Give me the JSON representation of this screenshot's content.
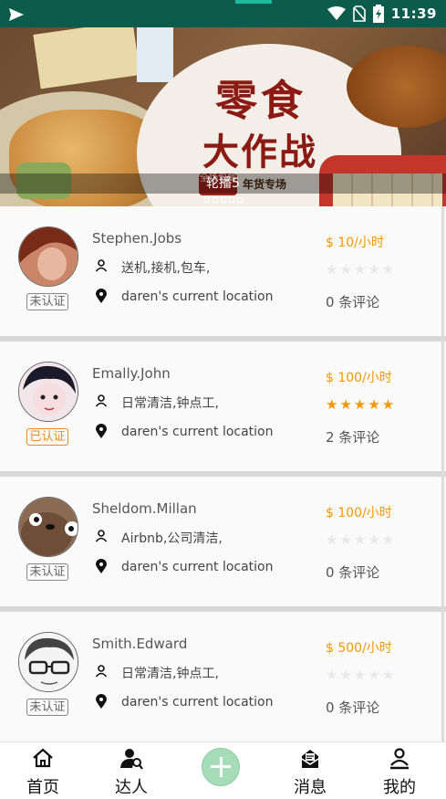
{
  "status_bar": {
    "time": "11:39",
    "icons": [
      "send-icon",
      "wifi-icon",
      "no-sim-icon",
      "battery-charging-icon"
    ]
  },
  "banner": {
    "title_line1": "零食",
    "title_line2": "大作战",
    "badge": "全场包邮",
    "subtitle": "年货专场",
    "caption": "轮播5",
    "dot_count": 5
  },
  "experts": [
    {
      "name": "Stephen.Jobs",
      "skills": "送机,接机,包车,",
      "location": "daren's current location",
      "price": "$ 10/小时",
      "rating": 0,
      "reviews": "0 条评论",
      "verify": "未认证",
      "verified": false
    },
    {
      "name": "Emally.John",
      "skills": "日常清洁,钟点工,",
      "location": "daren's current location",
      "price": "$ 100/小时",
      "rating": 4.5,
      "reviews": "2 条评论",
      "verify": "已认证",
      "verified": true
    },
    {
      "name": "Sheldom.Millan",
      "skills": "Airbnb,公司清洁,",
      "location": "daren's current location",
      "price": "$ 100/小时",
      "rating": 0,
      "reviews": "0 条评论",
      "verify": "未认证",
      "verified": false
    },
    {
      "name": "Smith.Edward",
      "skills": "日常清洁,钟点工,",
      "location": "daren's current location",
      "price": "$ 500/小时",
      "rating": 0,
      "reviews": "0 条评论",
      "verify": "未认证",
      "verified": false
    }
  ],
  "tabs": {
    "home": "首页",
    "experts": "达人",
    "messages": "消息",
    "mine": "我的"
  },
  "colors": {
    "status_bar": "#0b5c4d",
    "accent": "#f39800",
    "plus_button": "#a6dcb7"
  }
}
